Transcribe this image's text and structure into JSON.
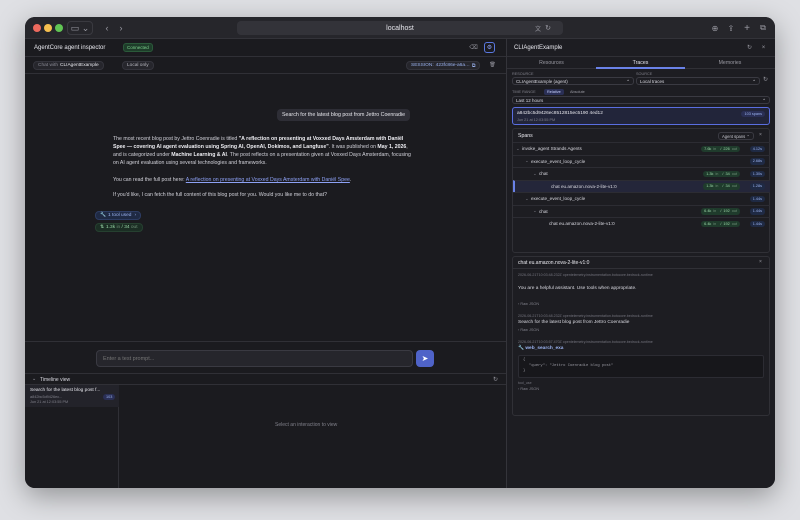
{
  "browser": {
    "url": "localhost",
    "back": "‹",
    "forward": "›"
  },
  "left": {
    "title": "AgentCore agent inspector",
    "status": "Connected",
    "chat_with_prefix": "Chat with",
    "agent_name": "CLIAgentExample",
    "mode": "Local only",
    "session_label": "SESSION:",
    "session_id": "423fc86e-a6a…",
    "user_message": "Search for the latest blog post from Jettro Coenradie",
    "reply": {
      "p1_a": "The most recent blog post by Jettro Coenradie is titled ",
      "p1_b": "\"A reflection on presenting at Voxxed Days Amsterdam with Daniël Spee — covering AI agent evaluation using Spring AI, OpenAI, Dokimos, and Langfuse\"",
      "p1_c": ". It was published on ",
      "p1_d": "May 1, 2026",
      "p1_e": ", and is categorized under ",
      "p1_f": "Machine Learning & AI",
      "p1_g": ". The post reflects on a presentation given at Voxxed Days Amsterdam, focusing on AI agent evaluation using several technologies and frameworks.",
      "p2_a": "You can read the full post here: ",
      "p2_link": "A reflection on presenting at Voxxed Days Amsterdam with Daniël Spee",
      "p2_b": ".",
      "p3": "If you'd like, I can fetch the full content of this blog post for you. Would you like me to do that?"
    },
    "tool_used": "1 tool used",
    "tokens": {
      "in": "1.3k",
      "in_label": "in",
      "out": "34",
      "out_label": "out"
    },
    "prompt_placeholder": "Enter a test prompt...",
    "timeline": {
      "title": "Timeline view",
      "item_title": "Search for the latest blog post f...",
      "item_id": "a842bc5d9426ec...",
      "item_date": "Jun 21 at 12:03:55 PM",
      "item_badge": "103",
      "empty_text": "Select an interaction to view"
    }
  },
  "right": {
    "title": "CLIAgentExample",
    "tabs": [
      "Resources",
      "Traces",
      "Memories"
    ],
    "active_tab": 1,
    "resource_label": "RESOURCE",
    "resource_value": "CLIAgentExample (agent)",
    "source_label": "SOURCE",
    "source_value": "Local traces",
    "time_range_label": "TIME RANGE",
    "time_modes": [
      "Relative",
      "Absolute"
    ],
    "time_value": "Last 12 hours",
    "trace": {
      "id": "a842bc5d9426ec8512815ec5190 4ed12",
      "date": "Jun 21 at 12:03:55 PM",
      "spans_badge": "103 spans"
    },
    "spans_title": "Spans",
    "spans_filter": "Agent spans",
    "spans": [
      {
        "name": "invoke_agent Strands Agents",
        "tin": "7.6k",
        "tout": "226",
        "dur": "4.12s"
      },
      {
        "name": "execute_event_loop_cycle",
        "tin": "",
        "tout": "",
        "dur": "2.68s"
      },
      {
        "name": "chat",
        "tin": "1.3k",
        "tout": "34",
        "dur": "1.30s"
      },
      {
        "name": "chat eu.amazon.nova-2-lite-v1:0",
        "tin": "1.3k",
        "tout": "34",
        "dur": "1.28s"
      },
      {
        "name": "execute_event_loop_cycle",
        "tin": "",
        "tout": "",
        "dur": "1.44s"
      },
      {
        "name": "chat",
        "tin": "6.4k",
        "tout": "192",
        "dur": "1.44s"
      },
      {
        "name": "chat eu.amazon.nova-2-lite-v1:0",
        "tin": "6.4k",
        "tout": "192",
        "dur": "1.44s"
      }
    ],
    "in_label": "in",
    "out_label": "out",
    "detail": {
      "title": "chat eu.amazon.nova-2-lite-v1:0",
      "ev1_meta": "2026-06-21T10:03:48.232Z  opentelemetry.instrumentation.botocore.bedrock-runtime",
      "ev1_text": "You are a helpful assistant. Use tools when appropriate.",
      "raw_json": "Raw JSON",
      "ev2_meta": "2026-06-21T10:03:48.232Z  opentelemetry.instrumentation.botocore.bedrock-runtime",
      "ev2_text": "Search for the latest blog post from Jettro Coenradie",
      "ev3_meta": "2026-06-21T10:03:57.470Z  opentelemetry.instrumentation.botocore.bedrock-runtime",
      "ev3_tool": "web_search_exa",
      "json_l1": "{",
      "json_l2": "\"query\": \"Jettro Coenradie blog post\"",
      "json_l3": "}",
      "tool_use": "tool_use"
    }
  }
}
